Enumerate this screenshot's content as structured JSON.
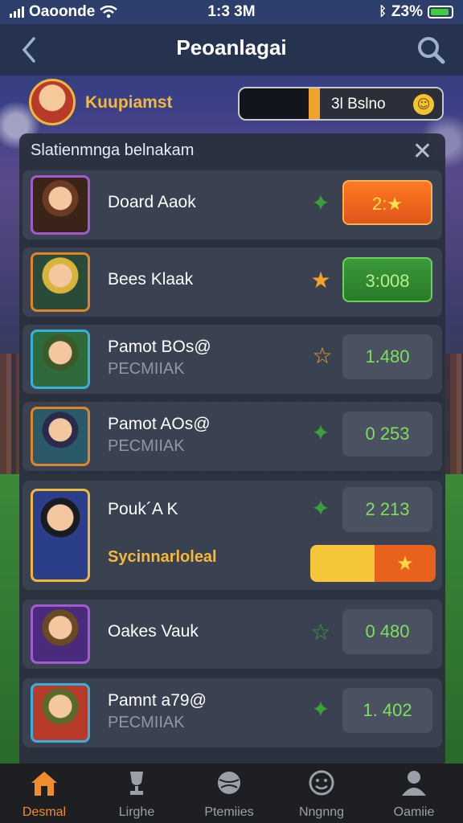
{
  "status_bar": {
    "carrier": "Oaoonde",
    "time": "1:3 3M",
    "battery": "Z3%"
  },
  "nav": {
    "title": "Peoanlagai"
  },
  "profile": {
    "name": "Kuupiamst",
    "coins": "3l Bslno"
  },
  "panel": {
    "title": "Slatienmnga belnakam"
  },
  "rows": [
    {
      "name": "Doard Aaok",
      "sub": "",
      "score": "2:★",
      "score_style": "orange"
    },
    {
      "name": "Bees Klaak",
      "sub": "",
      "score": "3:008",
      "score_style": "green"
    },
    {
      "name": "Pamot BOs@",
      "sub": "PECMIIAK",
      "score": "1.480",
      "score_style": "plain"
    },
    {
      "name": "Pamot AOs@",
      "sub": "PECMIIAK",
      "score": "0 253",
      "score_style": "plain"
    },
    {
      "name": "Pouk´A K",
      "sub": "Sycinnarloleal",
      "score": "2 213",
      "score_style": "plain"
    },
    {
      "name": "Oakes Vauk",
      "sub": "",
      "score": "0 480",
      "score_style": "plain"
    },
    {
      "name": "Pamnt a79@",
      "sub": "PECMIIAK",
      "score": "1. 402",
      "score_style": "plain"
    }
  ],
  "tabs": [
    {
      "label": "Desmal",
      "active": true
    },
    {
      "label": "Lirghe",
      "active": false
    },
    {
      "label": "Ptemiies",
      "active": false
    },
    {
      "label": "Nngnng",
      "active": false
    },
    {
      "label": "Oamiie",
      "active": false
    }
  ],
  "colors": {
    "accent": "#f08c2a",
    "gold": "#f5b93a",
    "score_green": "#7ee05a"
  }
}
